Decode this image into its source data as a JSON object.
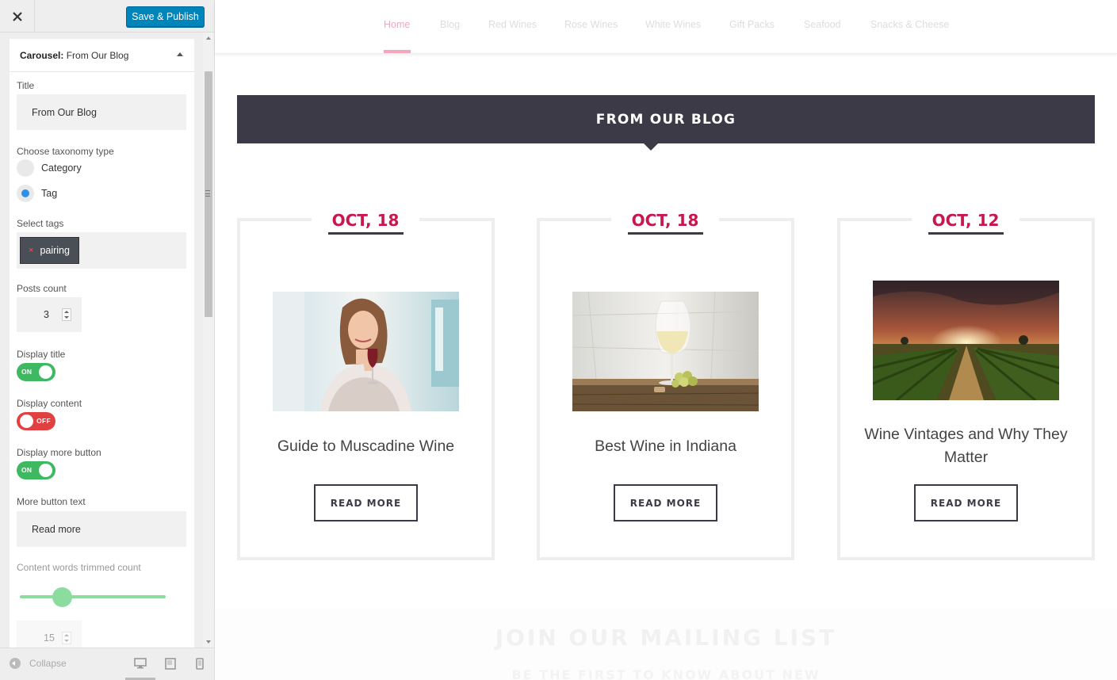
{
  "toolbar": {
    "publish_label": "Save & Publish"
  },
  "section": {
    "type_label": "Carousel:",
    "name": "From Our Blog"
  },
  "fields": {
    "title_label": "Title",
    "title_value": "From Our Blog",
    "taxonomy_label": "Choose taxonomy type",
    "taxonomy_options": [
      {
        "label": "Category",
        "checked": false
      },
      {
        "label": "Tag",
        "checked": true
      }
    ],
    "tags_label": "Select tags",
    "tags": [
      {
        "remove": "×",
        "label": "pairing"
      }
    ],
    "posts_count_label": "Posts count",
    "posts_count": "3",
    "display_title_label": "Display title",
    "display_title_state": "ON",
    "display_content_label": "Display content",
    "display_content_state": "OFF",
    "display_more_label": "Display more button",
    "display_more_state": "ON",
    "more_text_label": "More button text",
    "more_text_value": "Read more",
    "trim_label": "Content words trimmed count",
    "trim_value": "15"
  },
  "footer": {
    "collapse_label": "Collapse",
    "devices": [
      "desktop-icon",
      "tablet-icon",
      "mobile-icon"
    ]
  },
  "nav": {
    "items": [
      "Home",
      "Blog",
      "Red Wines",
      "Rose Wines",
      "White Wines",
      "Gift Packs",
      "Seafood",
      "Snacks & Cheese"
    ],
    "active": "Home"
  },
  "blog": {
    "heading": "FROM OUR BLOG",
    "posts": [
      {
        "date": "OCT, 18",
        "title": "Guide to Muscadine Wine",
        "button": "READ MORE",
        "image": "woman-with-red-wine-image"
      },
      {
        "date": "OCT, 18",
        "title": "Best Wine in Indiana",
        "button": "READ MORE",
        "image": "white-wine-glass-image"
      },
      {
        "date": "OCT, 12",
        "title": "Wine Vintages and Why They Matter",
        "button": "READ MORE",
        "image": "vineyard-sunset-image"
      }
    ]
  },
  "mailing": {
    "title": "JOIN OUR MAILING LIST",
    "subtitle": "BE THE FIRST TO KNOW ABOUT NEW"
  },
  "colors": {
    "accent": "#c8174e",
    "dark": "#3d3a47",
    "publish": "#0085ba",
    "toggle_on": "#3fb862",
    "toggle_off": "#e04040"
  }
}
